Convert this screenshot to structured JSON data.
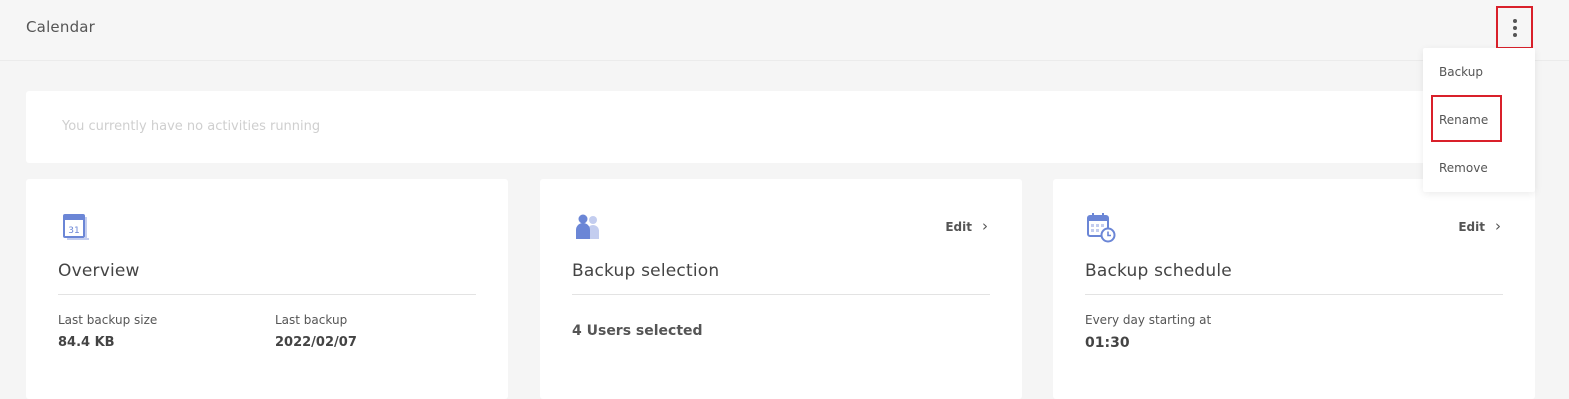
{
  "header": {
    "title": "Calendar",
    "more_icon": "vertical-ellipsis-icon"
  },
  "activity": {
    "text": "You currently have no activities running"
  },
  "overview": {
    "icon": "calendar-31-icon",
    "calendar_day": "31",
    "title": "Overview",
    "last_backup_size_label": "Last backup size",
    "last_backup_size_value": "84.4 KB",
    "last_backup_label": "Last backup",
    "last_backup_value": "2022/02/07"
  },
  "selection": {
    "icon": "users-icon",
    "title": "Backup selection",
    "edit_label": "Edit",
    "summary": "4 Users selected"
  },
  "schedule": {
    "icon": "calendar-clock-icon",
    "title": "Backup schedule",
    "edit_label": "Edit",
    "frequency_label": "Every day starting at",
    "time": "01:30"
  },
  "menu": {
    "items": [
      {
        "label": "Backup"
      },
      {
        "label": "Rename",
        "highlighted": true
      },
      {
        "label": "Remove"
      }
    ]
  },
  "colors": {
    "accent_blue": "#6b86d6",
    "highlight_red": "#d9202a",
    "background": "#f5f5f5"
  }
}
